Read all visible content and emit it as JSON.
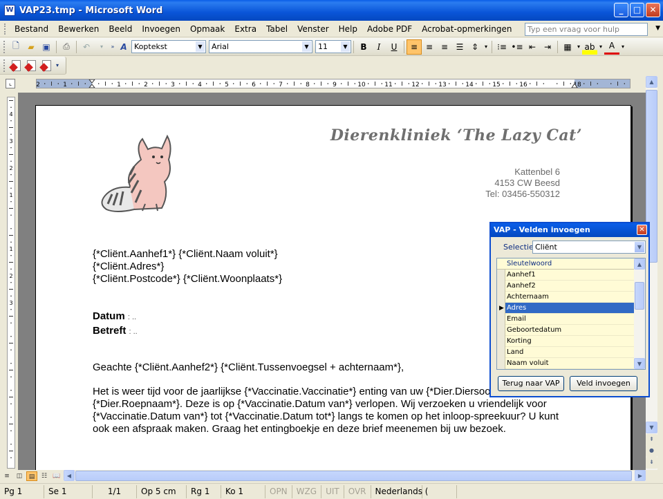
{
  "window": {
    "title": "VAP23.tmp - Microsoft Word",
    "minimize": "_",
    "maximize": "□",
    "close": "✕",
    "icon_letter": "W"
  },
  "menu": {
    "items": [
      "Bestand",
      "Bewerken",
      "Beeld",
      "Invoegen",
      "Opmaak",
      "Extra",
      "Tabel",
      "Venster",
      "Help",
      "Adobe PDF",
      "Acrobat-opmerkingen"
    ],
    "help_placeholder": "Typ een vraag voor hulp"
  },
  "format_toolbar": {
    "style": "Koptekst",
    "font": "Arial",
    "size": "11",
    "bold": "B",
    "italic": "I",
    "underline": "U"
  },
  "document": {
    "letterhead": "Dierenkliniek ‘The Lazy Cat’",
    "address_lines": [
      "Kattenbel 6",
      "4153 CW  Beesd",
      "Tel: 03456-550312"
    ],
    "recipient_lines": [
      "{*Cliënt.Aanhef1*} {*Cliënt.Naam voluit*}",
      "{*Cliënt.Adres*}",
      "{*Cliënt.Postcode*}   {*Cliënt.Woonplaats*}"
    ],
    "datum_label": "Datum",
    "datum_value": ": ..",
    "betreft_label": "Betreft",
    "betreft_value": ": ..",
    "greeting": "Geachte {*Cliënt.Aanhef2*} {*Cliënt.Tussenvoegsel + achternaam*},",
    "paragraph": "Het is weer tijd voor de jaarlijkse {*Vaccinatie.Vaccinatie*} enting van uw {*Dier.Diersoort*} {*Dier.Roepnaam*}. Deze is op {*Vaccinatie.Datum van*} verlopen. Wij verzoeken u vriendelijk voor {*Vaccinatie.Datum van*} tot {*Vaccinatie.Datum tot*} langs te komen op het inloop-spreekuur? U kunt ook een afspraak maken. Graag het entingboekje en deze brief meenemen bij uw bezoek."
  },
  "ruler": {
    "labels": [
      "2",
      "1",
      "1",
      "2",
      "3",
      "4",
      "5",
      "6",
      "7",
      "8",
      "9",
      "10",
      "11",
      "12",
      "13",
      "14",
      "15",
      "16",
      "18"
    ],
    "vlabels": [
      "5",
      "4",
      "3",
      "2",
      "1",
      "1",
      "2",
      "3"
    ]
  },
  "statusbar": {
    "page": "Pg 1",
    "section": "Se 1",
    "pages": "1/1",
    "position": "Op 5 cm",
    "line": "Rg 1",
    "column": "Ko 1",
    "opn": "OPN",
    "wzg": "WZG",
    "uit": "UIT",
    "ovr": "OVR",
    "language": "Nederlands ("
  },
  "vap_dialog": {
    "title": "VAP - Velden invoegen",
    "selection_label": "Selectie",
    "selection_value": "Cliënt",
    "grid_header": "Sleutelwoord",
    "rows": [
      "Aanhef1",
      "Aanhef2",
      "Achternaam",
      "Adres",
      "Email",
      "Geboortedatum",
      "Korting",
      "Land",
      "Naam voluit"
    ],
    "selected_index": 3,
    "back_button": "Terug naar VAP",
    "insert_button": "Veld invoegen"
  }
}
